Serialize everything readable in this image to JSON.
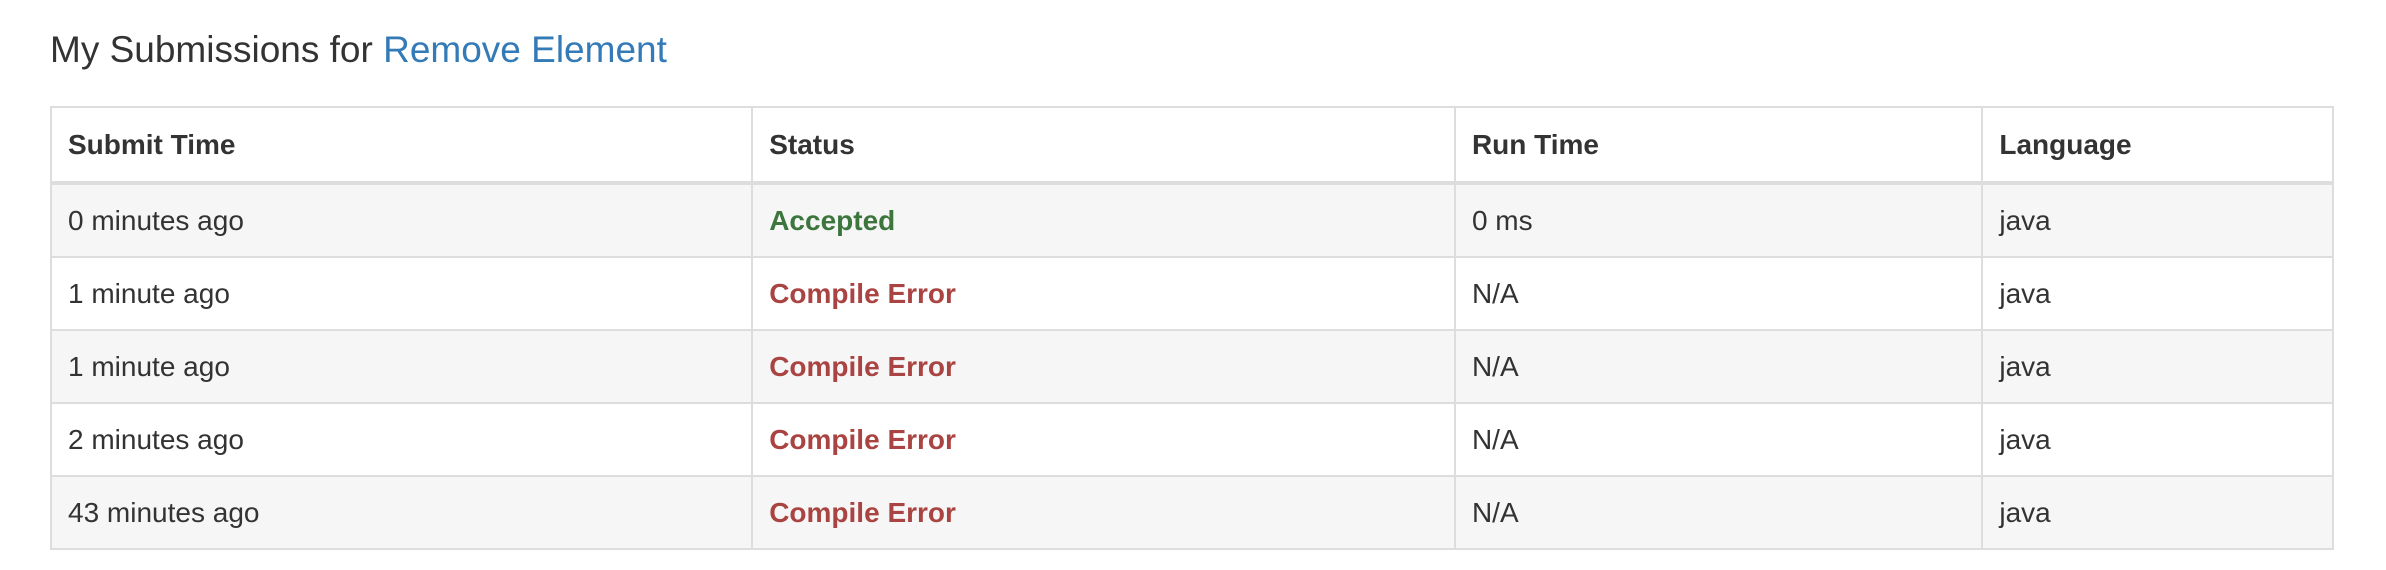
{
  "heading": {
    "prefix": "My Submissions for ",
    "problem_link": "Remove Element"
  },
  "colors": {
    "link": "#337ab7",
    "accepted": "#3c763d",
    "error": "#a94442",
    "row_stripe": "#f6f6f6",
    "border": "#dddddd"
  },
  "table": {
    "columns": [
      "Submit Time",
      "Status",
      "Run Time",
      "Language"
    ],
    "rows": [
      {
        "submit_time": "0 minutes ago",
        "status": "Accepted",
        "status_kind": "accepted",
        "run_time": "0 ms",
        "language": "java"
      },
      {
        "submit_time": "1 minute ago",
        "status": "Compile Error",
        "status_kind": "error",
        "run_time": "N/A",
        "language": "java"
      },
      {
        "submit_time": "1 minute ago",
        "status": "Compile Error",
        "status_kind": "error",
        "run_time": "N/A",
        "language": "java"
      },
      {
        "submit_time": "2 minutes ago",
        "status": "Compile Error",
        "status_kind": "error",
        "run_time": "N/A",
        "language": "java"
      },
      {
        "submit_time": "43 minutes ago",
        "status": "Compile Error",
        "status_kind": "error",
        "run_time": "N/A",
        "language": "java"
      }
    ]
  }
}
